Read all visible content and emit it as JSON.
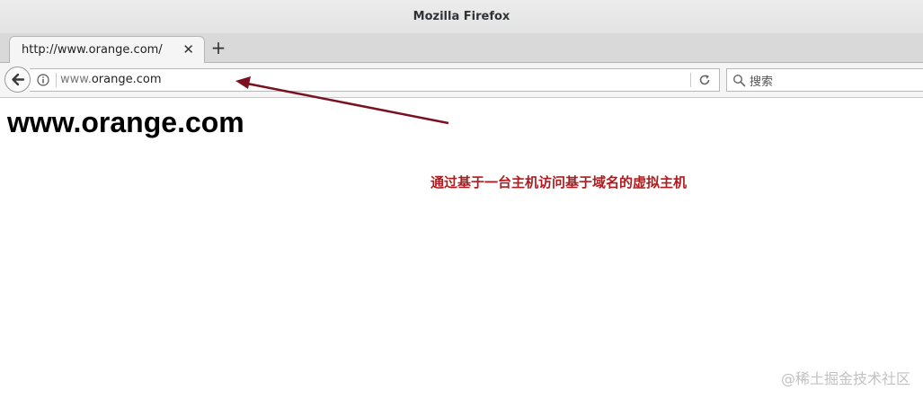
{
  "window": {
    "title": "Mozilla Firefox"
  },
  "tabs": [
    {
      "label": "http://www.orange.com/",
      "close_icon": "close-icon"
    }
  ],
  "newtab": {
    "icon": "plus-icon",
    "glyph": "+"
  },
  "navbar": {
    "back_icon": "back-arrow-icon",
    "url_prefix": "www.",
    "url_host": "orange.com",
    "info_icon": "info-icon",
    "reload_icon": "reload-icon",
    "search_placeholder": "搜索",
    "search_icon": "search-icon"
  },
  "page": {
    "heading": "www.orange.com"
  },
  "annotation": {
    "text": "通过基于一台主机访问基于域名的虚拟主机",
    "color": "#b01b1f",
    "arrow_color": "#7a1020"
  },
  "watermark": {
    "text": "@稀土掘金技术社区"
  }
}
